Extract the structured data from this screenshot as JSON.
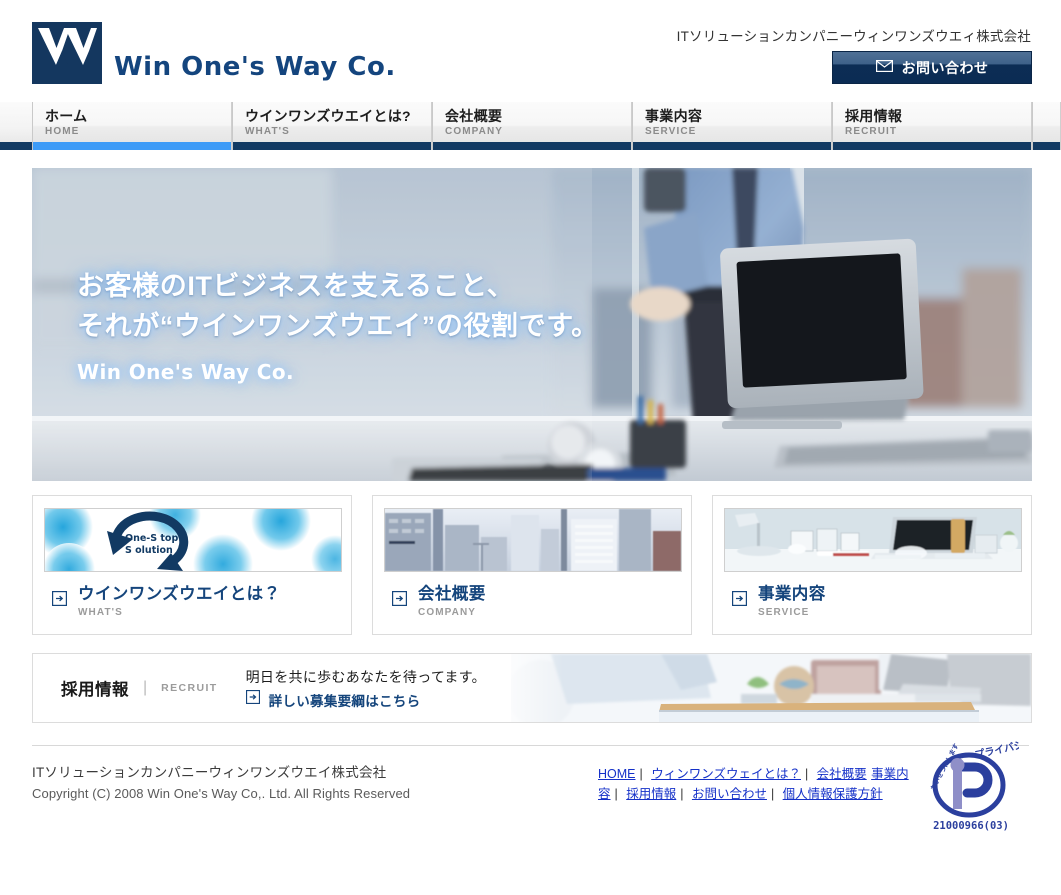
{
  "header": {
    "logo_text": "Win One's Way Co.",
    "logo_mark_name": "w-logo-mark",
    "corp_name": "ITソリューションカンパニーウィンワンズウエィ株式会社",
    "contact_label": "お問い合わせ",
    "contact_icon": "mail-icon"
  },
  "nav": {
    "items": [
      {
        "ja": "ホーム",
        "en": "HOME",
        "active": true
      },
      {
        "ja": "ウインワンズウエイとは?",
        "en": "WHAT'S",
        "active": false
      },
      {
        "ja": "会社概要",
        "en": "COMPANY",
        "active": false
      },
      {
        "ja": "事業内容",
        "en": "SERVICE",
        "active": false
      },
      {
        "ja": "採用情報",
        "en": "RECRUIT",
        "active": false
      }
    ]
  },
  "hero": {
    "line1": "お客様のITビジネスを支えること、",
    "line2": "それが“ウインワンズウエイ”の役割です。",
    "line3": "Win One's Way Co."
  },
  "cards": [
    {
      "ja": "ウインワンズウエイとは？",
      "en": "WHAT'S",
      "thumb": "one-stop-solution-graphic",
      "thumb_text_1": "One-Stop",
      "thumb_text_2": "Solution"
    },
    {
      "ja": "会社概要",
      "en": "COMPANY",
      "thumb": "city-buildings-photo"
    },
    {
      "ja": "事業内容",
      "en": "SERVICE",
      "thumb": "desk-laptop-photo"
    }
  ],
  "recruit": {
    "title_ja": "採用情報",
    "divider": "|",
    "title_en": "RECRUIT",
    "text": "明日を共に歩むあなたを待ってます。",
    "link": "詳しい募集要綱はこちら",
    "image": "office-meeting-photo"
  },
  "footer": {
    "company": "ITソリューションカンパニーウィンワンズウエイ株式会社",
    "copyright": "Copyright (C) 2008 Win One's Way Co,. Ltd. All Rights Reserved",
    "links": [
      "HOME",
      "ウィンワンズウェイとは？",
      "会社概要",
      "事業内容",
      "採用情報",
      "お問い合わせ",
      "個人情報保護方針"
    ],
    "separator": "|",
    "privacy_mark": {
      "top_text": "たいせつにします",
      "brand_text": "プライバシー",
      "number": "21000966(03)"
    }
  },
  "colors": {
    "navy": "#14375f",
    "logo_blue": "#14457e",
    "active_tab": "#3d9bf7",
    "nav_bar": "#123a63",
    "link_blue": "#1430c8"
  }
}
